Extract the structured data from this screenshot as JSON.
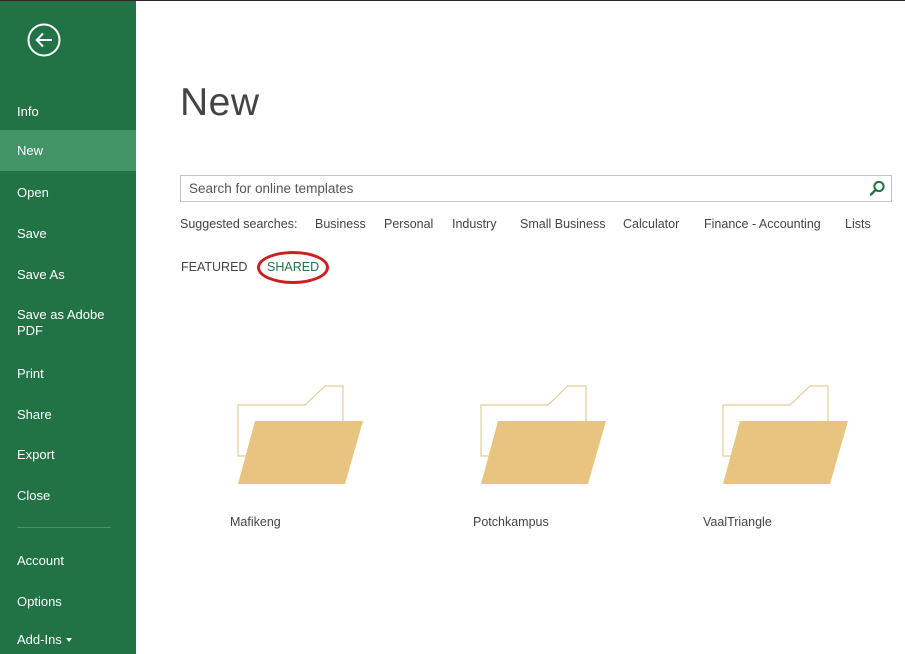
{
  "sidebar": {
    "items": [
      {
        "label": "Info"
      },
      {
        "label": "New"
      },
      {
        "label": "Open"
      },
      {
        "label": "Save"
      },
      {
        "label": "Save As"
      },
      {
        "label": "Save as Adobe PDF"
      },
      {
        "label": "Print"
      },
      {
        "label": "Share"
      },
      {
        "label": "Export"
      },
      {
        "label": "Close"
      },
      {
        "label": "Account"
      },
      {
        "label": "Options"
      },
      {
        "label": "Add-Ins"
      }
    ],
    "active": "New"
  },
  "main": {
    "title": "New",
    "search": {
      "placeholder": "Search for online templates",
      "value": ""
    },
    "suggested": {
      "label": "Suggested searches:",
      "links": [
        "Business",
        "Personal",
        "Industry",
        "Small Business",
        "Calculator",
        "Finance - Accounting",
        "Lists"
      ]
    },
    "tabs": [
      {
        "label": "FEATURED"
      },
      {
        "label": "SHARED"
      }
    ],
    "active_tab": "SHARED",
    "folders": [
      {
        "name": "Mafikeng"
      },
      {
        "name": "Potchkampus"
      },
      {
        "name": "VaalTriangle"
      }
    ]
  },
  "colors": {
    "brand": "#217346",
    "active_item": "#439467",
    "folder_fill": "#e8c480",
    "folder_outline": "#e0c68f",
    "highlight": "#cc1f1f"
  }
}
